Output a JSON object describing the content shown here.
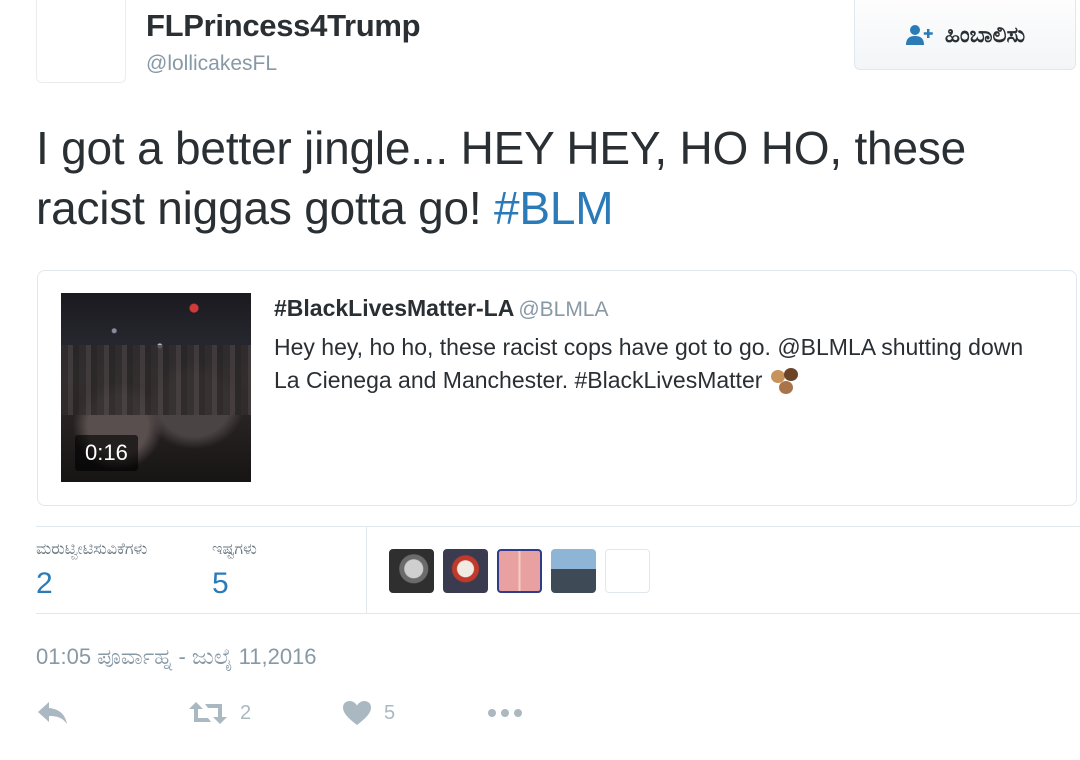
{
  "user": {
    "display_name": "FLPrincess4Trump",
    "handle": "@lollicakesFL",
    "follow_label": "ಹಿಂಬಾಲಿಸು"
  },
  "tweet": {
    "text": "I got a better jingle... HEY HEY, HO HO, these racist niggas gotta go!",
    "hashtag": "#BLM"
  },
  "quoted": {
    "name": "#BlackLivesMatter-LA",
    "handle": "@BLMLA",
    "text": "Hey hey, ho ho, these racist cops have got to go. @BLMLA shutting down La Cienega and Manchester. #BlackLivesMatter",
    "video_duration": "0:16"
  },
  "stats": {
    "retweets_label": "ಮರುಟ್ವೀಟಿಸುವಿಕೆಗಳು",
    "retweets_value": "2",
    "likes_label": "ಇಷ್ಟಗಳು",
    "likes_value": "5"
  },
  "timestamp": "01:05 ಪೂರ್ವಾಹ್ನ - ಜುಲೈ 11,2016",
  "actions": {
    "retweet_count": "2",
    "like_count": "5"
  },
  "colors": {
    "link": "#2b7bb9",
    "muted": "#8899a6",
    "icon": "#aab8c2"
  }
}
